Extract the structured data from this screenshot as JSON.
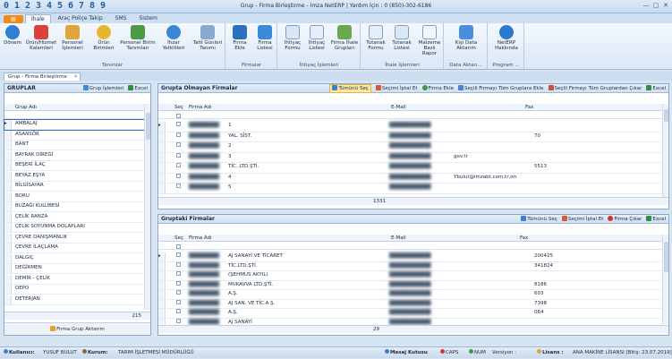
{
  "qat": [
    "0",
    "1",
    "2",
    "3",
    "4",
    "5",
    "6",
    "7",
    "8",
    "9"
  ],
  "window_title": "Grup - Firma Birleştirme - İmza NetERP | Yardım İçin : 0 (850)-302-6186",
  "ribbon_tabs": [
    "İhale",
    "Araç Poliçe Takip",
    "SMS",
    "Sistem"
  ],
  "ribbon": {
    "tanimlar": {
      "label": "Tanımlar",
      "buttons": [
        "Dönem",
        "Ürün/Hizmet Kalemleri",
        "Personel İşlemleri",
        "Ürün Birimleri",
        "Personel Birim Tanımları",
        "İhzar Yetkilileri",
        "Tatil Günleri Tanımı"
      ]
    },
    "firmalar": {
      "label": "Firmalar",
      "buttons": [
        "Firma Ekle",
        "Firma Listesi"
      ]
    },
    "ihtiyac": {
      "label": "İhtiyaç İşlemleri",
      "buttons": [
        "İhtiyaç Formu",
        "İhtiyaç Listesi",
        "Firma İhale Grupları"
      ]
    },
    "ihale": {
      "label": "İhale İşlemleri",
      "buttons": [
        "Tutanak Formu",
        "Tutanak Listesi",
        "Malzeme Bazlı Rapor"
      ]
    },
    "data": {
      "label": "Data Aktarı...",
      "buttons": [
        "Kişi Data Aktarım"
      ]
    },
    "program": {
      "label": "Program ...",
      "buttons": [
        "NetERP Hakkında"
      ]
    }
  },
  "doc_tab": "Grup - Firma Birleştirme",
  "groups_panel": {
    "title": "GRUPLAR",
    "actions": [
      "Grup İşlemleri",
      "Excel"
    ],
    "column": "Grup Adı",
    "rows": [
      "AMBALAJ",
      "ASANSÖR",
      "BANT",
      "BAYRAK DİREĞİ",
      "BEŞERİ İLAÇ",
      "BEYAZ EŞYA",
      "BİLGİSAYAR",
      "BORU",
      "BUZAĞI KULUBESİ",
      "ÇELİK RANZA",
      "ÇELİK SOYUNMA DOLAPLARI",
      "ÇEVRE DANIŞMANLIK",
      "ÇEVRE İLAÇLAMA",
      "DALGIÇ",
      "DEĞİRMEN",
      "DEMİR - ÇELİK",
      "DEPO",
      "DETERJAN"
    ],
    "count": "215",
    "bottom_button": "Firma Grup Aktarım"
  },
  "not_in_group": {
    "title": "Grupta Olmayan Firmalar",
    "actions": [
      "Tümünü Seç",
      "Seçimi İptal Et",
      "Firma Ekle",
      "Seçili Firmayı Tüm Gruplara Ekle",
      "Seçili Firmayı Tüm Gruplardan Çıkar",
      "Excel"
    ],
    "columns": [
      "Seç",
      "Firma Adı",
      "E-Mail",
      "Fax"
    ],
    "rows": [
      [
        "1",
        "",
        ""
      ],
      [
        "YAL. SİST.",
        "",
        "70"
      ],
      [
        "2",
        "",
        ""
      ],
      [
        "3",
        "gov.tr",
        ""
      ],
      [
        "TİC. LTD.ŞTİ.",
        "",
        "5513"
      ],
      [
        "4",
        "Ybulut@imzabt.com.tr,omer.elci6@gmail.com",
        ""
      ],
      [
        "5",
        "",
        ""
      ]
    ],
    "count": "1331"
  },
  "in_group": {
    "title": "Gruptaki Firmalar",
    "actions": [
      "Tümünü Seç",
      "Seçimi İptal Et",
      "Firma Çıkar",
      "Excel"
    ],
    "columns": [
      "Seç",
      "Firma Adı",
      "E-Mail",
      "Fax"
    ],
    "rows": [
      [
        "AJ SANAYİ VE TİCARET",
        "",
        "200425"
      ],
      [
        "TİC.LTD.ŞTİ.",
        "",
        "341824"
      ],
      [
        "(ŞEHMUS AKYIL)",
        "",
        ""
      ],
      [
        "MUKAVVA LTD.ŞTİ.",
        "",
        "8186"
      ],
      [
        "A.Ş.",
        "",
        "603"
      ],
      [
        "AJ SAN. VE TİC.A.Ş.",
        "",
        "7398"
      ],
      [
        "A.Ş.",
        "",
        "064"
      ],
      [
        "AJ SANAYİ",
        "",
        ""
      ]
    ],
    "count": "29"
  },
  "status": {
    "user_label": "Kullanıcı:",
    "user": "YUSUF BULUT",
    "kurum_label": "Kurum:",
    "kurum": "TARIM İŞLETMESİ MÜDÜRLÜĞÜ",
    "mesaj": "Mesaj Kutusu",
    "caps": "CAPS",
    "num": "NUM",
    "version_label": "Versiyon :",
    "lisans_label": "Lisans :",
    "lisans": "ANA MAKİNE LİSANSI [Bitiş: 23.07.2019]"
  }
}
